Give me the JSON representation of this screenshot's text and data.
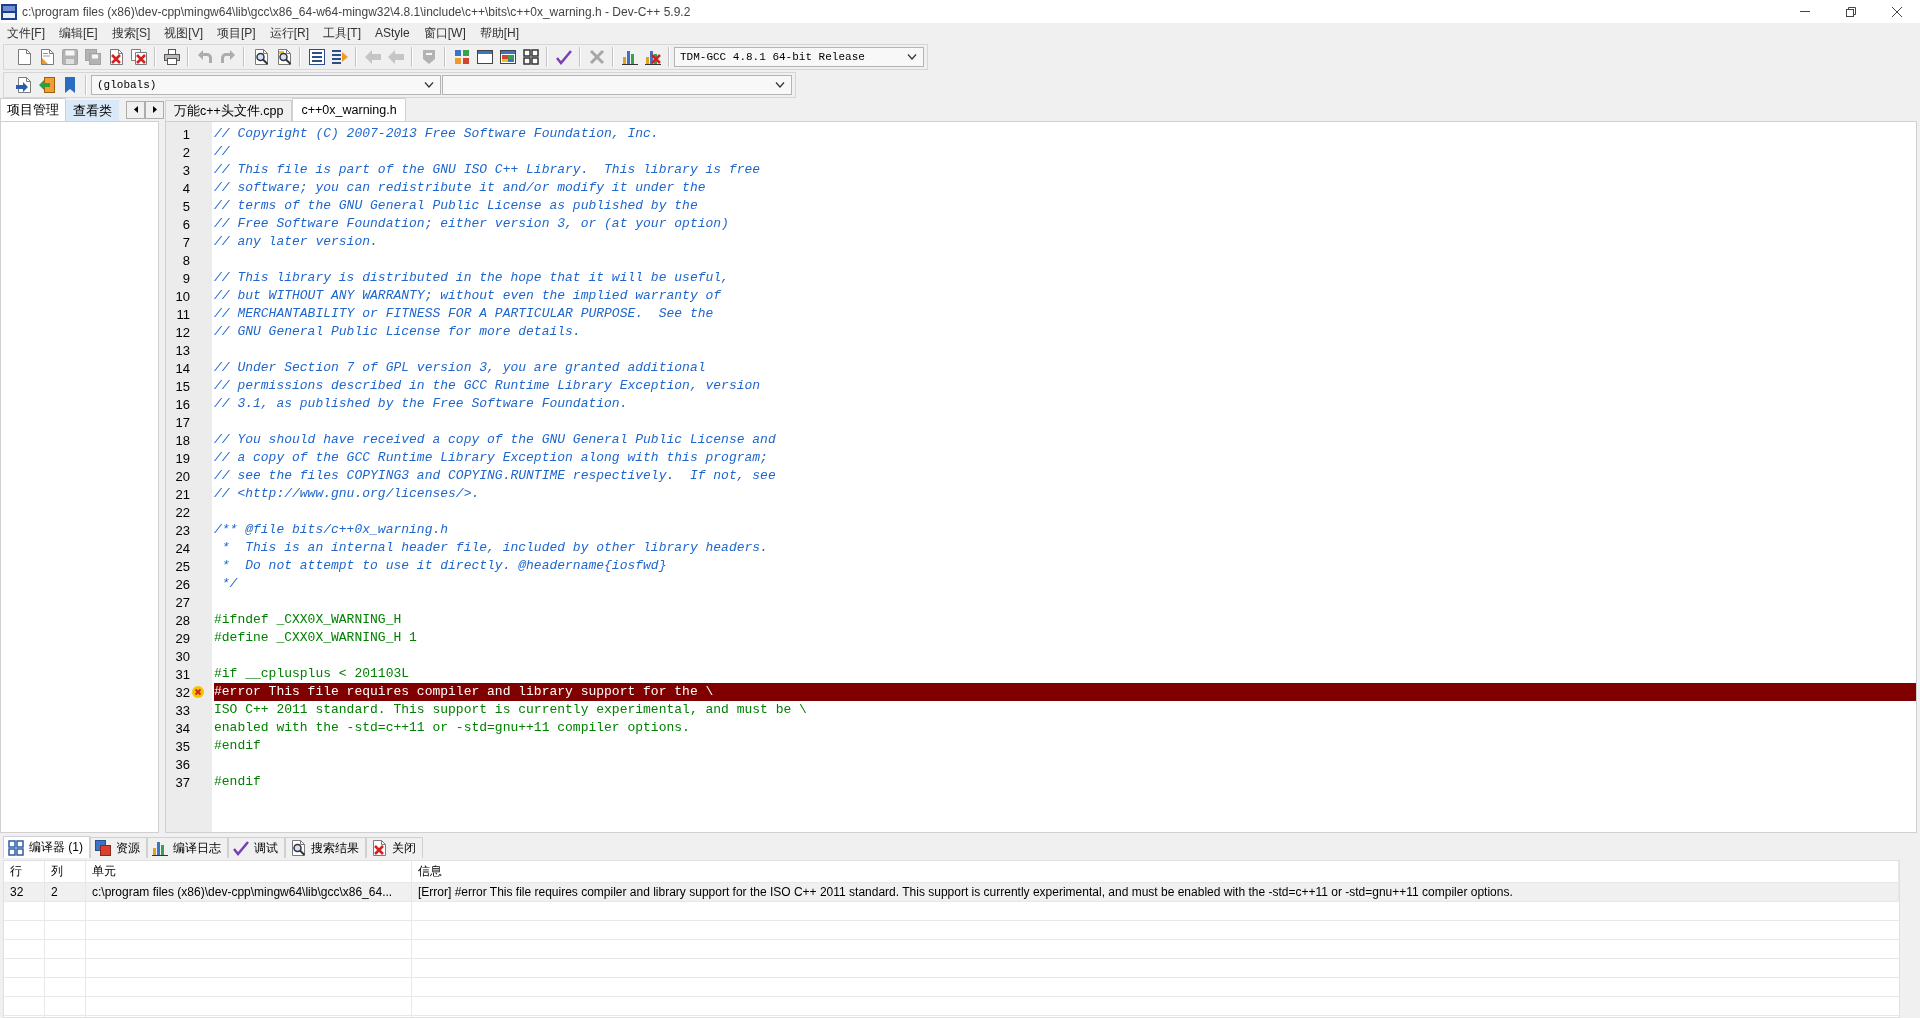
{
  "window": {
    "title": "c:\\program files (x86)\\dev-cpp\\mingw64\\lib\\gcc\\x86_64-w64-mingw32\\4.8.1\\include\\c++\\bits\\c++0x_warning.h - Dev-C++ 5.9.2"
  },
  "menu": [
    "文件[F]",
    "编辑[E]",
    "搜索[S]",
    "视图[V]",
    "项目[P]",
    "运行[R]",
    "工具[T]",
    "AStyle",
    "窗口[W]",
    "帮助[H]"
  ],
  "toolbar": {
    "row1": [
      [
        {
          "disabled": false
        },
        {
          "disabled": false
        },
        {
          "disabled": true
        },
        {
          "disabled": true
        },
        {
          "disabled": false
        },
        {
          "disabled": false
        }
      ],
      [
        {
          "disabled": false
        }
      ],
      [
        {
          "disabled": true
        },
        {
          "disabled": true
        }
      ],
      [
        {
          "disabled": false
        },
        {
          "disabled": false
        }
      ],
      [
        {
          "disabled": false
        },
        {
          "disabled": false
        }
      ],
      [
        {
          "disabled": true
        },
        {
          "disabled": true
        }
      ],
      [
        {
          "disabled": true
        }
      ],
      [
        {
          "disabled": false
        },
        {
          "disabled": false
        },
        {
          "disabled": false
        },
        {
          "disabled": false
        }
      ],
      [
        {
          "disabled": false
        }
      ],
      [
        {
          "disabled": true
        }
      ],
      [
        {
          "disabled": false
        },
        {
          "disabled": false
        }
      ]
    ],
    "compiler": "TDM-GCC 4.8.1 64-bit Release",
    "row2": [
      {
        "disabled": false
      },
      {
        "disabled": false
      },
      {
        "disabled": false
      }
    ],
    "scope": "(globals)"
  },
  "side_panel": {
    "tabs": [
      {
        "label": "项目管理",
        "selected": true
      },
      {
        "label": "查看类",
        "selected": false
      }
    ]
  },
  "editor": {
    "tabs": [
      {
        "label": "万能c++头文件.cpp",
        "selected": false
      },
      {
        "label": "c++0x_warning.h",
        "selected": true
      }
    ],
    "lines": [
      {
        "number": "1",
        "kind": "comment",
        "text": "// Copyright (C) 2007-2013 Free Software Foundation, Inc.",
        "error": false
      },
      {
        "number": "2",
        "kind": "comment",
        "text": "//",
        "error": false
      },
      {
        "number": "3",
        "kind": "comment",
        "text": "// This file is part of the GNU ISO C++ Library.  This library is free",
        "error": false
      },
      {
        "number": "4",
        "kind": "comment",
        "text": "// software; you can redistribute it and/or modify it under the",
        "error": false
      },
      {
        "number": "5",
        "kind": "comment",
        "text": "// terms of the GNU General Public License as published by the",
        "error": false
      },
      {
        "number": "6",
        "kind": "comment",
        "text": "// Free Software Foundation; either version 3, or (at your option)",
        "error": false
      },
      {
        "number": "7",
        "kind": "comment",
        "text": "// any later version.",
        "error": false
      },
      {
        "number": "8",
        "error": false
      },
      {
        "number": "9",
        "kind": "comment",
        "text": "// This library is distributed in the hope that it will be useful,",
        "error": false
      },
      {
        "number": "10",
        "kind": "comment",
        "text": "// but WITHOUT ANY WARRANTY; without even the implied warranty of",
        "error": false
      },
      {
        "number": "11",
        "kind": "comment",
        "text": "// MERCHANTABILITY or FITNESS FOR A PARTICULAR PURPOSE.  See the",
        "error": false
      },
      {
        "number": "12",
        "kind": "comment",
        "text": "// GNU General Public License for more details.",
        "error": false
      },
      {
        "number": "13",
        "error": false
      },
      {
        "number": "14",
        "kind": "comment",
        "text": "// Under Section 7 of GPL version 3, you are granted additional",
        "error": false
      },
      {
        "number": "15",
        "kind": "comment",
        "text": "// permissions described in the GCC Runtime Library Exception, version",
        "error": false
      },
      {
        "number": "16",
        "kind": "comment",
        "text": "// 3.1, as published by the Free Software Foundation.",
        "error": false
      },
      {
        "number": "17",
        "error": false
      },
      {
        "number": "18",
        "kind": "comment",
        "text": "// You should have received a copy of the GNU General Public License and",
        "error": false
      },
      {
        "number": "19",
        "kind": "comment",
        "text": "// a copy of the GCC Runtime Library Exception along with this program;",
        "error": false
      },
      {
        "number": "20",
        "kind": "comment",
        "text": "// see the files COPYING3 and COPYING.RUNTIME respectively.  If not, see",
        "error": false
      },
      {
        "number": "21",
        "kind": "comment",
        "text": "// <http://www.gnu.org/licenses/>.",
        "error": false
      },
      {
        "number": "22",
        "error": false
      },
      {
        "number": "23",
        "kind": "comment",
        "text": "/** @file bits/c++0x_warning.h",
        "error": false
      },
      {
        "number": "24",
        "kind": "comment",
        "text": " *  This is an internal header file, included by other library headers.",
        "error": false
      },
      {
        "number": "25",
        "kind": "comment",
        "text": " *  Do not attempt to use it directly. @headername{iosfwd}",
        "error": false
      },
      {
        "number": "26",
        "kind": "comment",
        "text": " */",
        "error": false
      },
      {
        "number": "27",
        "error": false
      },
      {
        "number": "28",
        "kind": "code",
        "text": "#ifndef _CXX0X_WARNING_H",
        "error": false
      },
      {
        "number": "29",
        "kind": "code",
        "text": "#define _CXX0X_WARNING_H 1",
        "error": false
      },
      {
        "number": "30",
        "error": false
      },
      {
        "number": "31",
        "kind": "code",
        "text": "#if __cplusplus < 201103L",
        "error": false
      },
      {
        "number": "32",
        "kind": "code",
        "text": "#error This file requires compiler and library support for the \\",
        "error": true
      },
      {
        "number": "33",
        "kind": "code",
        "text": "ISO C++ 2011 standard. This support is currently experimental, and must be \\",
        "error": false
      },
      {
        "number": "34",
        "kind": "code",
        "text": "enabled with the -std=c++11 or -std=gnu++11 compiler options.",
        "error": false
      },
      {
        "number": "35",
        "kind": "code",
        "text": "#endif",
        "error": false
      },
      {
        "number": "36",
        "error": false
      },
      {
        "number": "37",
        "kind": "code",
        "text": "#endif",
        "error": false
      }
    ]
  },
  "messages": {
    "tabs": [
      {
        "label": "编译器 (1)",
        "selected": true
      },
      {
        "label": "资源",
        "selected": false
      },
      {
        "label": "编译日志",
        "selected": false
      },
      {
        "label": "调试",
        "selected": false
      },
      {
        "label": "搜索结果",
        "selected": false
      },
      {
        "label": "关闭",
        "selected": false
      }
    ],
    "columns": [
      "行",
      "列",
      "单元",
      "信息"
    ],
    "rows": [
      {
        "cells": [
          "32",
          "2",
          "c:\\program files (x86)\\dev-cpp\\mingw64\\lib\\gcc\\x86_64...",
          "[Error] #error This file requires compiler and library support for the ISO C++ 2011 standard. This support is currently experimental, and must be enabled with the -std=c++11 or -std=gnu++11 compiler options."
        ],
        "selected": true
      }
    ]
  }
}
